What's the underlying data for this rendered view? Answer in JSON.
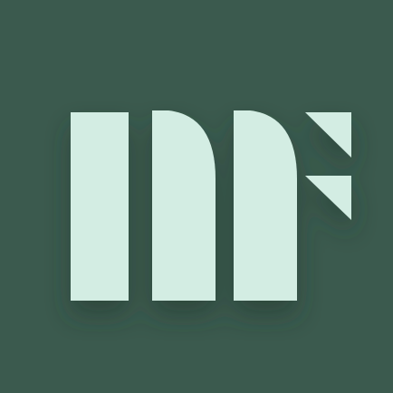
{
  "icon": {
    "name": "mf-logo-icon",
    "colors": {
      "background": "#3B5A4E",
      "shape": "#D3EDE3",
      "shadow": "#23392F"
    }
  }
}
